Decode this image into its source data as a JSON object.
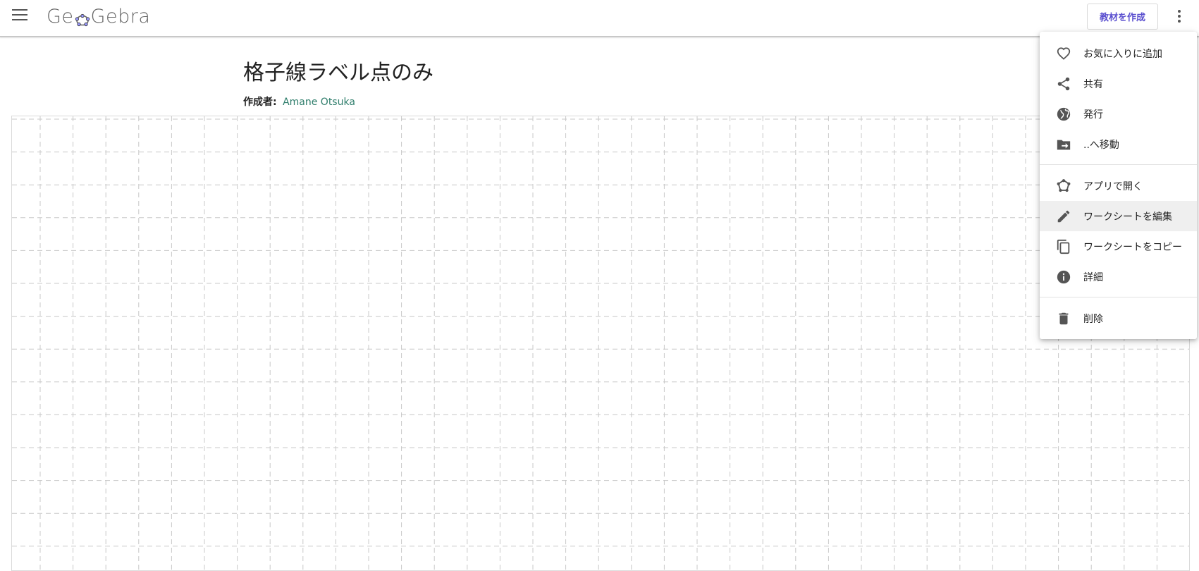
{
  "header": {
    "logo_text_left": "Ge",
    "logo_text_right": "Gebra",
    "create_button": "教材を作成"
  },
  "page": {
    "title": "格子線ラベル点のみ",
    "author_label": "作成者:",
    "author_name": "Amane Otsuka"
  },
  "menu": {
    "items": [
      {
        "label": "お気に入りに追加",
        "icon": "heart-outline-icon"
      },
      {
        "label": "共有",
        "icon": "share-icon"
      },
      {
        "label": "発行",
        "icon": "globe-icon"
      },
      {
        "label": "..へ移動",
        "icon": "folder-move-icon"
      },
      {
        "label": "アプリで開く",
        "icon": "geogebra-app-icon"
      },
      {
        "label": "ワークシートを編集",
        "icon": "pencil-icon"
      },
      {
        "label": "ワークシートをコピー",
        "icon": "copy-icon"
      },
      {
        "label": "詳細",
        "icon": "info-icon"
      },
      {
        "label": "削除",
        "icon": "trash-icon"
      }
    ]
  },
  "colors": {
    "accent": "#5a4fcf",
    "author_link": "#2e7d6b",
    "grid_line": "#c8c8c8",
    "icon": "#555555"
  }
}
